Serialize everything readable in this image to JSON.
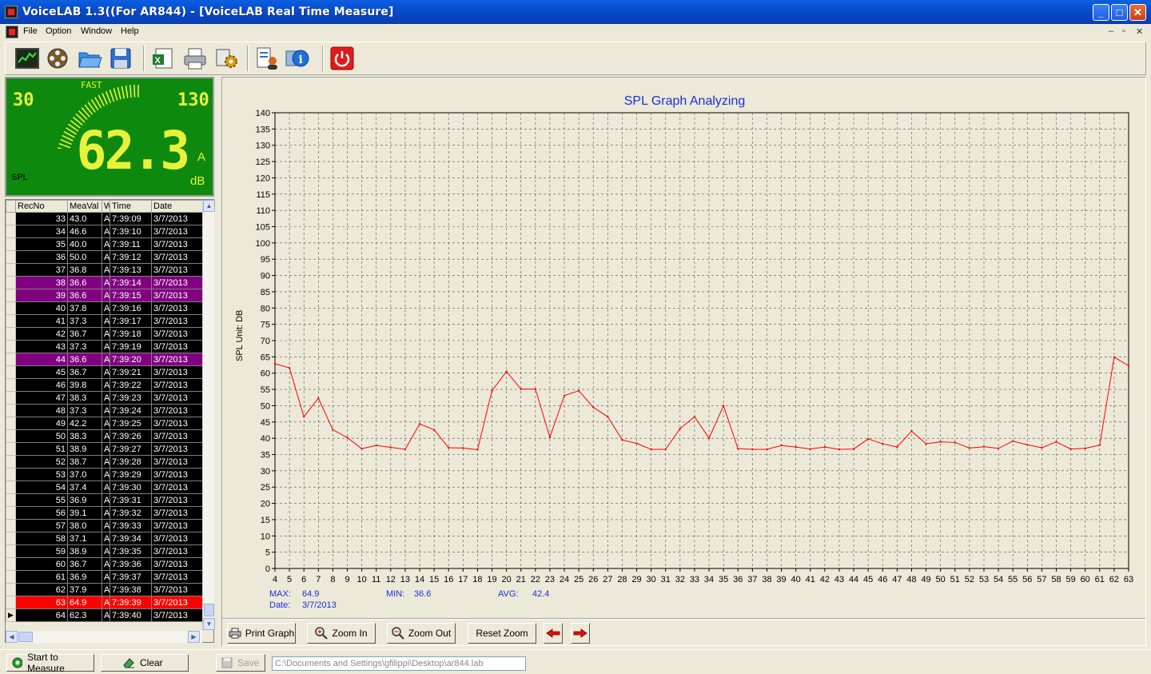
{
  "window": {
    "title": "VoiceLAB 1.3((For AR844) - [VoiceLAB Real Time Measure]",
    "min_glyph": "_",
    "max_glyph": "□",
    "close_glyph": "✕"
  },
  "menu": {
    "items": [
      "File",
      "Option",
      "Window",
      "Help"
    ],
    "mdi_controls": [
      "–",
      "▫",
      "✕"
    ]
  },
  "toolbar": {
    "icons": [
      "chart-monitor-icon",
      "film-reel-icon",
      "open-folder-icon",
      "save-disk-icon",
      "excel-export-icon",
      "printer-icon",
      "settings-gear-icon",
      "report-user-icon",
      "info-icon",
      "power-icon"
    ]
  },
  "meter": {
    "response": "FAST",
    "range_low": "30",
    "range_high": "130",
    "reading": "62.3",
    "weighting": "A",
    "unit": "dB",
    "mode": "SPL",
    "color_bg": "#0d8a0d",
    "color_digits": "#e8f23c"
  },
  "records": {
    "columns": [
      "RecNo",
      "MeaVal",
      "W",
      "Time",
      "Date"
    ],
    "rows": [
      {
        "rec": "33",
        "val": "43.0",
        "w": "A",
        "time": "7:39:09",
        "date": "3/7/2013",
        "hl": "black"
      },
      {
        "rec": "34",
        "val": "46.6",
        "w": "A",
        "time": "7:39:10",
        "date": "3/7/2013",
        "hl": "black"
      },
      {
        "rec": "35",
        "val": "40.0",
        "w": "A",
        "time": "7:39:11",
        "date": "3/7/2013",
        "hl": "black"
      },
      {
        "rec": "36",
        "val": "50.0",
        "w": "A",
        "time": "7:39:12",
        "date": "3/7/2013",
        "hl": "black"
      },
      {
        "rec": "37",
        "val": "36.8",
        "w": "A",
        "time": "7:39:13",
        "date": "3/7/2013",
        "hl": "black"
      },
      {
        "rec": "38",
        "val": "36.6",
        "w": "A",
        "time": "7:39:14",
        "date": "3/7/2013",
        "hl": "purple"
      },
      {
        "rec": "39",
        "val": "36.6",
        "w": "A",
        "time": "7:39:15",
        "date": "3/7/2013",
        "hl": "purple"
      },
      {
        "rec": "40",
        "val": "37.8",
        "w": "A",
        "time": "7:39:16",
        "date": "3/7/2013",
        "hl": "black"
      },
      {
        "rec": "41",
        "val": "37.3",
        "w": "A",
        "time": "7:39:17",
        "date": "3/7/2013",
        "hl": "black"
      },
      {
        "rec": "42",
        "val": "36.7",
        "w": "A",
        "time": "7:39:18",
        "date": "3/7/2013",
        "hl": "black"
      },
      {
        "rec": "43",
        "val": "37.3",
        "w": "A",
        "time": "7:39:19",
        "date": "3/7/2013",
        "hl": "black"
      },
      {
        "rec": "44",
        "val": "36.6",
        "w": "A",
        "time": "7:39:20",
        "date": "3/7/2013",
        "hl": "purple"
      },
      {
        "rec": "45",
        "val": "36.7",
        "w": "A",
        "time": "7:39:21",
        "date": "3/7/2013",
        "hl": "black"
      },
      {
        "rec": "46",
        "val": "39.8",
        "w": "A",
        "time": "7:39:22",
        "date": "3/7/2013",
        "hl": "black"
      },
      {
        "rec": "47",
        "val": "38.3",
        "w": "A",
        "time": "7:39:23",
        "date": "3/7/2013",
        "hl": "black"
      },
      {
        "rec": "48",
        "val": "37.3",
        "w": "A",
        "time": "7:39:24",
        "date": "3/7/2013",
        "hl": "black"
      },
      {
        "rec": "49",
        "val": "42.2",
        "w": "A",
        "time": "7:39:25",
        "date": "3/7/2013",
        "hl": "black"
      },
      {
        "rec": "50",
        "val": "38.3",
        "w": "A",
        "time": "7:39:26",
        "date": "3/7/2013",
        "hl": "black"
      },
      {
        "rec": "51",
        "val": "38.9",
        "w": "A",
        "time": "7:39:27",
        "date": "3/7/2013",
        "hl": "black"
      },
      {
        "rec": "52",
        "val": "38.7",
        "w": "A",
        "time": "7:39:28",
        "date": "3/7/2013",
        "hl": "black"
      },
      {
        "rec": "53",
        "val": "37.0",
        "w": "A",
        "time": "7:39:29",
        "date": "3/7/2013",
        "hl": "black"
      },
      {
        "rec": "54",
        "val": "37.4",
        "w": "A",
        "time": "7:39:30",
        "date": "3/7/2013",
        "hl": "black"
      },
      {
        "rec": "55",
        "val": "36.9",
        "w": "A",
        "time": "7:39:31",
        "date": "3/7/2013",
        "hl": "black"
      },
      {
        "rec": "56",
        "val": "39.1",
        "w": "A",
        "time": "7:39:32",
        "date": "3/7/2013",
        "hl": "black"
      },
      {
        "rec": "57",
        "val": "38.0",
        "w": "A",
        "time": "7:39:33",
        "date": "3/7/2013",
        "hl": "black"
      },
      {
        "rec": "58",
        "val": "37.1",
        "w": "A",
        "time": "7:39:34",
        "date": "3/7/2013",
        "hl": "black"
      },
      {
        "rec": "59",
        "val": "38.9",
        "w": "A",
        "time": "7:39:35",
        "date": "3/7/2013",
        "hl": "black"
      },
      {
        "rec": "60",
        "val": "36.7",
        "w": "A",
        "time": "7:39:36",
        "date": "3/7/2013",
        "hl": "black"
      },
      {
        "rec": "61",
        "val": "36.9",
        "w": "A",
        "time": "7:39:37",
        "date": "3/7/2013",
        "hl": "black"
      },
      {
        "rec": "62",
        "val": "37.9",
        "w": "A",
        "time": "7:39:38",
        "date": "3/7/2013",
        "hl": "black"
      },
      {
        "rec": "63",
        "val": "64.9",
        "w": "A",
        "time": "7:39:39",
        "date": "3/7/2013",
        "hl": "red"
      },
      {
        "rec": "64",
        "val": "62.3",
        "w": "A",
        "time": "7:39:40",
        "date": "3/7/2013",
        "hl": "black",
        "current": true
      }
    ]
  },
  "graph": {
    "stats": {
      "max_label": "MAX:",
      "max_value": "64.9",
      "min_label": "MIN:",
      "min_value": "36.6",
      "avg_label": "AVG:",
      "avg_value": "42.4",
      "date_label": "Date:",
      "date_value": "3/7/2013"
    },
    "buttons": {
      "print": "Print Graph",
      "zoom_in": "Zoom In",
      "zoom_out": "Zoom Out",
      "reset": "Reset Zoom"
    }
  },
  "chart_data": {
    "type": "line",
    "title": "SPL Graph Analyzing",
    "xlabel": "",
    "ylabel": "SPL  Unit: DB",
    "x": [
      4,
      5,
      6,
      7,
      8,
      9,
      10,
      11,
      12,
      13,
      14,
      15,
      16,
      17,
      18,
      19,
      20,
      21,
      22,
      23,
      24,
      25,
      26,
      27,
      28,
      29,
      30,
      31,
      32,
      33,
      34,
      35,
      36,
      37,
      38,
      39,
      40,
      41,
      42,
      43,
      44,
      45,
      46,
      47,
      48,
      49,
      50,
      51,
      52,
      53,
      54,
      55,
      56,
      57,
      58,
      59,
      60,
      61,
      62,
      63
    ],
    "series": [
      {
        "name": "",
        "color": "#ff0000",
        "values": [
          62.9,
          61.6,
          46.6,
          52.3,
          42.6,
          40.2,
          36.8,
          37.8,
          37.2,
          36.6,
          44.4,
          42.6,
          37.1,
          37.0,
          36.5,
          54.6,
          60.5,
          55.1,
          55.1,
          40.3,
          53.1,
          54.6,
          49.5,
          46.6,
          39.5,
          38.4,
          36.6,
          36.6,
          43.0,
          46.6,
          40.0,
          50.0,
          36.8,
          36.6,
          36.6,
          37.8,
          37.3,
          36.7,
          37.3,
          36.6,
          36.7,
          39.8,
          38.3,
          37.3,
          42.2,
          38.3,
          38.9,
          38.7,
          37.0,
          37.4,
          36.9,
          39.1,
          38.0,
          37.1,
          38.9,
          36.7,
          36.9,
          37.9,
          64.9,
          62.3
        ]
      }
    ],
    "ylim": [
      0,
      140
    ],
    "yticks": [
      0,
      5,
      10,
      15,
      20,
      25,
      30,
      35,
      40,
      45,
      50,
      55,
      60,
      65,
      70,
      75,
      80,
      85,
      90,
      95,
      100,
      105,
      110,
      115,
      120,
      125,
      130,
      135,
      140
    ],
    "grid": true,
    "grid_style": "dashed",
    "background": "#ece9d8"
  },
  "status": {
    "start": "Start to Measure",
    "clear": "Clear",
    "save": "Save",
    "file_path": "C:\\Documents and Settings\\gfilippi\\Desktop\\ar844.lab"
  }
}
